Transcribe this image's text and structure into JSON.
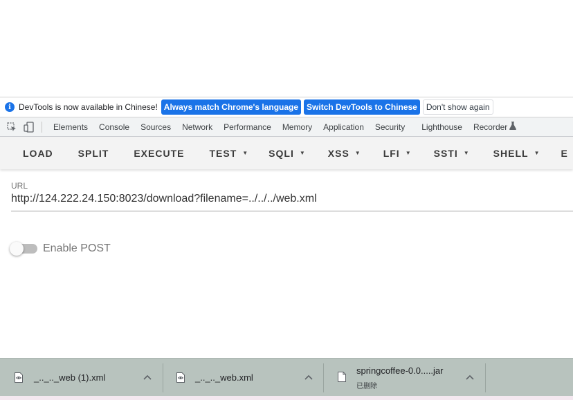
{
  "infobar": {
    "message": "DevTools is now available in Chinese!",
    "match_language_label": "Always match Chrome's language",
    "switch_label": "Switch DevTools to Chinese",
    "dont_show_label": "Don't show again"
  },
  "devtools_tabs": [
    "Elements",
    "Console",
    "Sources",
    "Network",
    "Performance",
    "Memory",
    "Application",
    "Security",
    "Lighthouse",
    "Recorder"
  ],
  "hackbar": {
    "load": "LOAD",
    "split": "SPLIT",
    "execute": "EXECUTE",
    "test": "TEST",
    "sqli": "SQLI",
    "xss": "XSS",
    "lfi": "LFI",
    "ssti": "SSTI",
    "shell": "SHELL",
    "cut_off": "E"
  },
  "url_field": {
    "label": "URL",
    "value": "http://124.222.24.150:8023/download?filename=../../../web.xml"
  },
  "post_toggle": {
    "label": "Enable POST",
    "enabled": false
  },
  "downloads": [
    {
      "name": "_.._.._web (1).xml",
      "icon": "xml-file-icon"
    },
    {
      "name": "_.._.._web.xml",
      "icon": "xml-file-icon"
    },
    {
      "name": "springcoffee-0.0.....jar",
      "status": "已删除",
      "icon": "file-icon"
    }
  ],
  "colors": {
    "accent_blue": "#1a73e8",
    "shelf_bg": "#b8c3be",
    "hackbar_bg": "#f3f3f3"
  }
}
